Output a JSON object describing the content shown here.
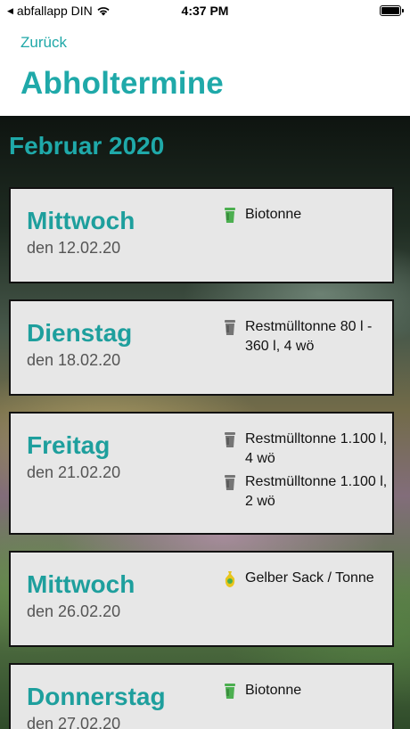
{
  "status_bar": {
    "carrier": "abfallapp DIN",
    "time": "4:37 PM"
  },
  "nav": {
    "back_label": "Zurück",
    "title": "Abholtermine"
  },
  "month_heading": "Februar 2020",
  "appointments": [
    {
      "weekday": "Mittwoch",
      "date": "den 12.02.20",
      "entries": [
        {
          "icon": "biotonne-bin-icon",
          "label": "Biotonne",
          "color": "#4caf50"
        }
      ]
    },
    {
      "weekday": "Dienstag",
      "date": "den 18.02.20",
      "entries": [
        {
          "icon": "restmuell-bin-icon",
          "label": "Restmülltonne 80 l - 360 l, 4 wö",
          "color": "#757575"
        }
      ]
    },
    {
      "weekday": "Freitag",
      "date": "den 21.02.20",
      "entries": [
        {
          "icon": "restmuell-bin-icon",
          "label": "Restmülltonne 1.100 l, 4 wö",
          "color": "#757575"
        },
        {
          "icon": "restmuell-bin-icon",
          "label": "Restmülltonne 1.100 l, 2 wö",
          "color": "#757575"
        }
      ]
    },
    {
      "weekday": "Mittwoch",
      "date": "den 26.02.20",
      "entries": [
        {
          "icon": "gelber-sack-icon",
          "label": "Gelber Sack / Tonne",
          "color": "#e8c51c"
        }
      ]
    },
    {
      "weekday": "Donnerstag",
      "date": "den 27.02.20",
      "entries": [
        {
          "icon": "biotonne-bin-icon",
          "label": "Biotonne",
          "color": "#4caf50"
        }
      ]
    }
  ],
  "colors": {
    "accent": "#1fa9a9",
    "card_background": "#e7e7e7",
    "card_border": "#111111"
  }
}
